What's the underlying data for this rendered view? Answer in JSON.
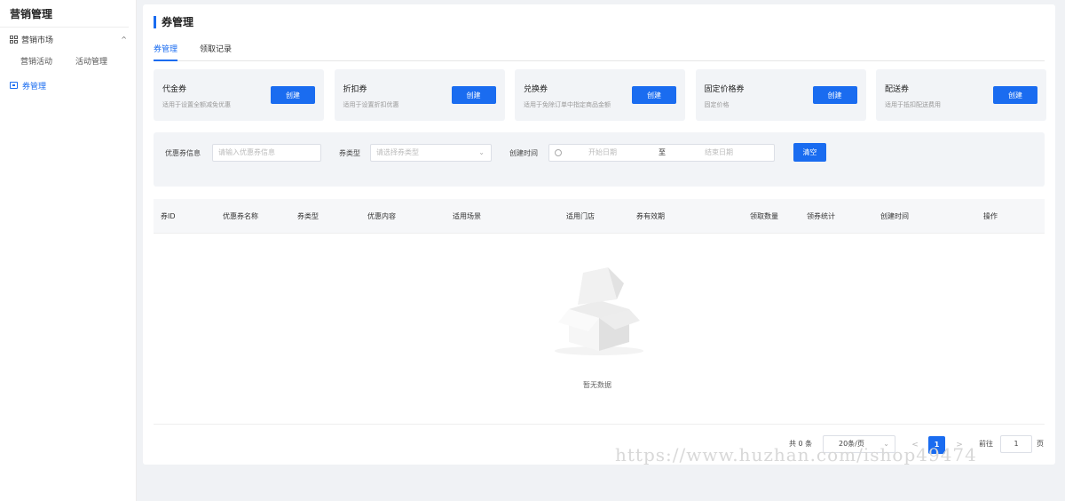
{
  "sidebar": {
    "title": "营销管理",
    "group_label": "营销市场",
    "group_chevron": "^",
    "sub_items": [
      "营销活动",
      "活动管理"
    ],
    "active_item": "券管理"
  },
  "page": {
    "title": "券管理"
  },
  "tabs": [
    {
      "label": "券管理",
      "active": true
    },
    {
      "label": "领取记录",
      "active": false
    }
  ],
  "coupon_cards": [
    {
      "title": "代金券",
      "desc": "适用于设置全额减免优惠",
      "button": "创建"
    },
    {
      "title": "折扣券",
      "desc": "适用于设置折扣优惠",
      "button": "创建"
    },
    {
      "title": "兑换券",
      "desc": "适用于免除订单中指定商品金额",
      "button": "创建"
    },
    {
      "title": "固定价格券",
      "desc": "固定价格",
      "button": "创建"
    },
    {
      "title": "配送券",
      "desc": "适用于抵扣配送费用",
      "button": "创建"
    }
  ],
  "filters": {
    "info_label": "优惠券信息",
    "info_placeholder": "请输入优惠券信息",
    "type_label": "券类型",
    "type_placeholder": "请选择券类型",
    "time_label": "创建时间",
    "start_placeholder": "开始日期",
    "range_sep": "至",
    "end_placeholder": "结束日期",
    "clear_button": "清空"
  },
  "table": {
    "columns": [
      "券ID",
      "优惠券名称",
      "券类型",
      "优惠内容",
      "适用场景",
      "适用门店",
      "券有效期",
      "领取数量",
      "领券统计",
      "创建时间",
      "操作"
    ],
    "empty_text": "暂无数据"
  },
  "pagination": {
    "total_text": "共 0 条",
    "page_size": "20条/页",
    "prev": "<",
    "current_page": "1",
    "next": ">",
    "goto_label": "前往",
    "goto_value": "1",
    "page_suffix": "页"
  },
  "watermark": "https://www.huzhan.com/ishop49474",
  "colors": {
    "accent": "#1a6cf0",
    "card_bg": "#f2f4f7",
    "page_bg": "#f0f2f5"
  }
}
